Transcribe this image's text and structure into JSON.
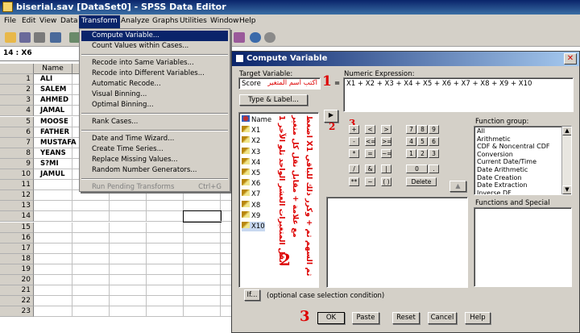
{
  "window": {
    "title": "biserial.sav [DataSet0] - SPSS Data Editor"
  },
  "menubar": {
    "items": [
      "File",
      "Edit",
      "View",
      "Data",
      "Transform",
      "Analyze",
      "Graphs",
      "Utilities",
      "Window",
      "Help"
    ],
    "active": "Transform"
  },
  "cell_ref": "14 : X6",
  "grid": {
    "column_header": "Name",
    "rows": [
      "1",
      "2",
      "3",
      "4",
      "5",
      "6",
      "7",
      "8",
      "9",
      "10",
      "11",
      "12",
      "13",
      "14",
      "15",
      "16",
      "17",
      "18",
      "19",
      "20",
      "21",
      "22",
      "23"
    ],
    "names": [
      "ALI",
      "SALEM",
      "AHMED",
      "JAMAL",
      "MOOSE",
      "FATHER",
      "MUSTAFA",
      "YEANS",
      "S?MI",
      "JAMUL"
    ]
  },
  "transform_menu": {
    "items": [
      {
        "label": "Compute Variable...",
        "selected": true
      },
      {
        "label": "Count Values within Cases..."
      },
      {
        "sep": true
      },
      {
        "label": "Recode into Same Variables..."
      },
      {
        "label": "Recode into Different Variables..."
      },
      {
        "label": "Automatic Recode..."
      },
      {
        "label": "Visual Binning..."
      },
      {
        "label": "Optimal Binning..."
      },
      {
        "sep": true
      },
      {
        "label": "Rank Cases..."
      },
      {
        "sep": true
      },
      {
        "label": "Date and Time Wizard..."
      },
      {
        "label": "Create Time Series..."
      },
      {
        "label": "Replace Missing Values..."
      },
      {
        "label": "Random Number Generators..."
      },
      {
        "sep": true
      },
      {
        "label": "Run Pending Transforms",
        "shortcut": "Ctrl+G",
        "disabled": true
      }
    ]
  },
  "dialog": {
    "title": "Compute Variable",
    "target_label": "Target Variable:",
    "target_value": "Score",
    "target_arabic": "اكتب اسم المتغير",
    "equals": "=",
    "numeric_label": "Numeric Expression:",
    "numeric_value": "X1 + X2 + X3 + X4 + X5 + X6 + X7 + X8 + X9 + X10",
    "type_label_btn": "Type & Label...",
    "variables": [
      "Name",
      "X1",
      "X2",
      "X3",
      "X4",
      "X5",
      "X6",
      "X7",
      "X8",
      "X9",
      "X10"
    ],
    "arabic_col1": "1  انقل المتغيرات العشر الواحد تلو الآخر",
    "arabic_col2": "مع علامة + مقابل نقل كل متغير",
    "arabic_col3": "اضغط X1 ثم السهم ثم + وكرر ذلك للباقي",
    "calc_buttons": [
      "+",
      "<",
      ">",
      "7",
      "8",
      "9",
      "-",
      "<=",
      ">=",
      "4",
      "5",
      "6",
      "*",
      "=",
      "~=",
      "1",
      "2",
      "3",
      "/",
      "&",
      "|",
      "0",
      ".",
      "**",
      "~",
      "( )",
      "Delete"
    ],
    "function_group_label": "Function group:",
    "function_groups": [
      "All",
      "Arithmetic",
      "CDF & Noncentral CDF",
      "Conversion",
      "Current Date/Time",
      "Date Arithmetic",
      "Date Creation",
      "Date Extraction",
      "Inverse DF"
    ],
    "functions_label": "Functions and Special Variables:",
    "if_btn": "If...",
    "if_text": "(optional case selection condition)",
    "buttons": {
      "ok": "OK",
      "paste": "Paste",
      "reset": "Reset",
      "cancel": "Cancel",
      "help": "Help"
    },
    "step_numbers": {
      "n1": "1",
      "n2": "2",
      "n3": "3",
      "n2b": "2",
      "n3b": "3"
    }
  }
}
